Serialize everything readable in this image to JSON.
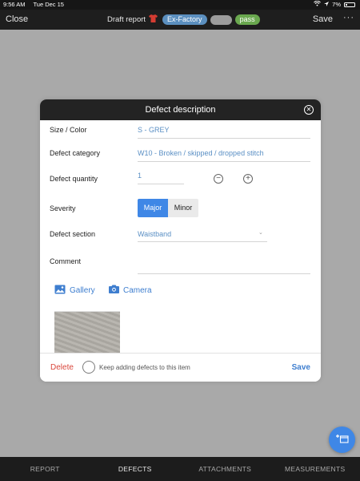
{
  "status_bar": {
    "time": "9:56 AM",
    "date": "Tue Dec 15",
    "battery": "7%"
  },
  "nav": {
    "close_label": "Close",
    "title": "Draft report",
    "badge_exfactory": "Ex-Factory",
    "badge_gray": "",
    "badge_pass": "pass",
    "save_label": "Save",
    "more_label": "···"
  },
  "modal": {
    "title": "Defect description",
    "size_color_label": "Size / Color",
    "size_color_value": "S - GREY",
    "category_label": "Defect category",
    "category_value": "W10 - Broken / skipped / dropped stitch",
    "quantity_label": "Defect quantity",
    "quantity_value": "1",
    "severity_label": "Severity",
    "severity_major": "Major",
    "severity_minor": "Minor",
    "severity_selected": "Major",
    "section_label": "Defect section",
    "section_value": "Waistband",
    "comment_label": "Comment",
    "comment_value": "",
    "gallery_label": "Gallery",
    "camera_label": "Camera",
    "delete_label": "Delete",
    "keep_adding_label": "Keep adding defects to this item",
    "footer_save_label": "Save"
  },
  "tabs": [
    {
      "label": "REPORT",
      "active": false
    },
    {
      "label": "DEFECTS",
      "active": true
    },
    {
      "label": "ATTACHMENTS",
      "active": false
    },
    {
      "label": "MEASUREMENTS",
      "active": false
    }
  ],
  "colors": {
    "accent": "#3f87e6",
    "delete": "#d9463b",
    "exfactory_badge": "#5b8fbf",
    "pass_badge": "#6aa84f"
  }
}
